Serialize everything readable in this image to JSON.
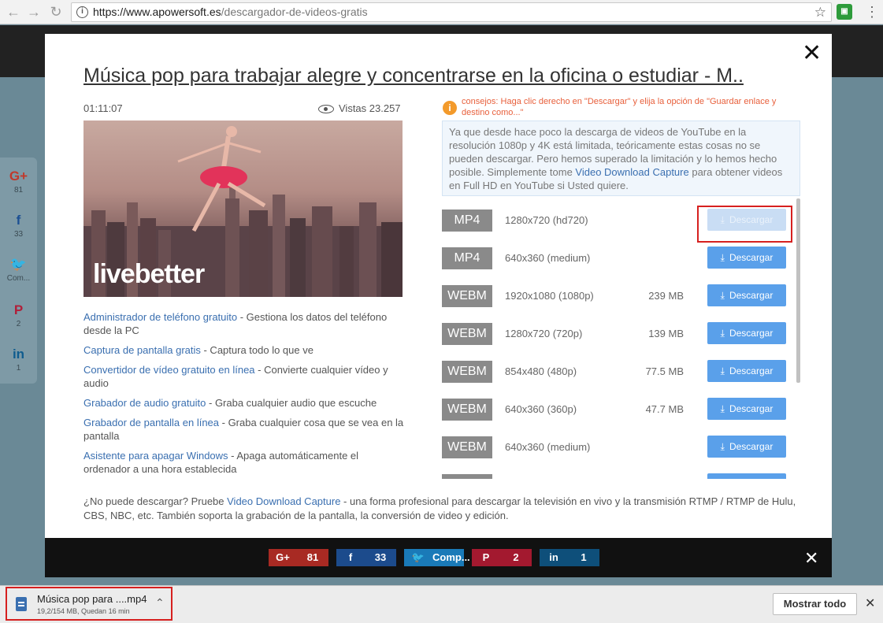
{
  "browser": {
    "url_host": "https://www.apowersoft.es",
    "url_path": "/descargador-de-videos-gratis",
    "back_icon": "arrow-left-icon",
    "forward_icon": "arrow-right-icon",
    "reload_icon": "reload-icon",
    "star": "☆"
  },
  "video": {
    "title": "Música pop para trabajar alegre y concentrarse en la oficina o estudiar - M..",
    "duration": "01:11:07",
    "views": "Vistas 23.257",
    "thumb_brand": "livebetter"
  },
  "side_share": [
    {
      "icon": "G+",
      "count": "81",
      "color": "#c0392b"
    },
    {
      "icon": "f",
      "count": "33",
      "color": "#1b4f93"
    },
    {
      "icon": "🐦",
      "count": "Com...",
      "color": "#1f8ccf"
    },
    {
      "icon": "P",
      "count": "2",
      "color": "#b0203a"
    },
    {
      "icon": "in",
      "count": "1",
      "color": "#0f5c8e"
    }
  ],
  "links": [
    {
      "link": "Administrador de teléfono gratuito",
      "desc": " - Gestiona los datos del teléfono desde la PC"
    },
    {
      "link": "Captura de pantalla gratis",
      "desc": " - Captura todo lo que ve"
    },
    {
      "link": "Convertidor de vídeo gratuito en línea",
      "desc": " - Convierte cualquier vídeo y audio"
    },
    {
      "link": "Grabador de audio gratuito",
      "desc": " - Graba cualquier audio que escuche"
    },
    {
      "link": "Grabador de pantalla en línea",
      "desc": " - Graba cualquier cosa que se vea en la pantalla"
    },
    {
      "link": "Asistente para apagar Windows",
      "desc": " - Apaga automáticamente el ordenador a una hora establecida"
    }
  ],
  "tip": "consejos: Haga clic derecho en \"Descargar\" y elija la opción de \"Guardar enlace y destino como...\"",
  "notice": {
    "text_before": "Ya que desde hace poco la descarga de videos de YouTube en la resolución 1080p y 4K está limitada, teóricamente estas cosas no se pueden descargar. Pero hemos superado la limitación y lo hemos hecho posible. Simplemente tome ",
    "link": "Video Download Capture",
    "text_after": " para obtener videos en Full HD en YouTube si Usted quiere."
  },
  "download_label": "Descargar",
  "formats": [
    {
      "fmt": "MP4",
      "res": "1280x720 (hd720)",
      "size": "",
      "state": "faded"
    },
    {
      "fmt": "MP4",
      "res": "640x360 (medium)",
      "size": "",
      "state": "normal"
    },
    {
      "fmt": "WEBM",
      "res": "1920x1080 (1080p)",
      "size": "239 MB",
      "state": "normal"
    },
    {
      "fmt": "WEBM",
      "res": "1280x720 (720p)",
      "size": "139 MB",
      "state": "normal"
    },
    {
      "fmt": "WEBM",
      "res": "854x480 (480p)",
      "size": "77.5 MB",
      "state": "normal"
    },
    {
      "fmt": "WEBM",
      "res": "640x360 (360p)",
      "size": "47.7 MB",
      "state": "normal"
    },
    {
      "fmt": "WEBM",
      "res": "640x360 (medium)",
      "size": "",
      "state": "normal"
    },
    {
      "fmt": "",
      "res": "",
      "size": "",
      "state": "normal"
    }
  ],
  "bottom_note": {
    "before": "¿No puede descargar? Pruebe ",
    "link": "Video Download Capture",
    "after": " - una forma profesional para descargar la televisión en vivo y la transmisión RTMP / RTMP de Hulu, CBS, NBC, etc. También soporta la grabación de la pantalla, la conversión de video y edición."
  },
  "share_bar": [
    {
      "icon": "G+",
      "count": "81",
      "color": "#a82a23"
    },
    {
      "icon": "f",
      "count": "33",
      "color": "#1c4b8c"
    },
    {
      "icon": "🐦",
      "count": "Comp...",
      "color": "#1a7ab8"
    },
    {
      "icon": "P",
      "count": "2",
      "color": "#a3192f"
    },
    {
      "icon": "in",
      "count": "1",
      "color": "#0e4f7a"
    }
  ],
  "download_bar": {
    "file_name": "Música pop para ....mp4",
    "progress": "19,2/154 MB, Quedan 16 min",
    "show_all": "Mostrar todo"
  }
}
